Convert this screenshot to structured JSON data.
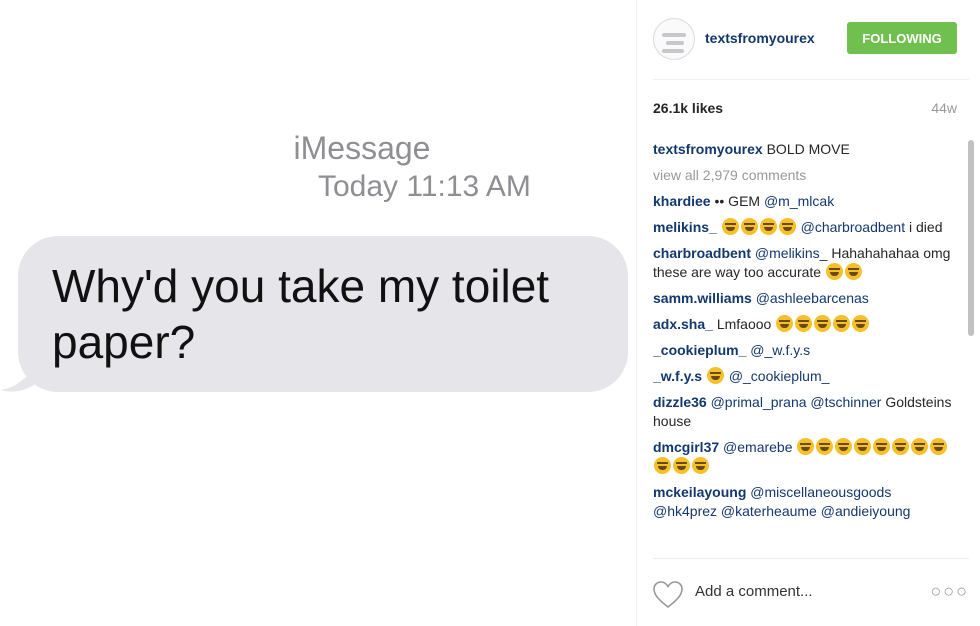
{
  "photo": {
    "imessage_label": "iMessage",
    "time_label": "Today 11:13 AM",
    "message_text": "Why'd you take my toilet paper?",
    "bubble_color": "#e5e5ea"
  },
  "post": {
    "username": "textsfromyourex",
    "follow_label": "FOLLOWING",
    "likes": "26.1k likes",
    "age": "44w",
    "caption_author": "textsfromyourex",
    "caption_text": "BOLD MOVE",
    "view_all": "view all 2,979 comments",
    "comments": [
      {
        "author": "khardiee",
        "text": "•• GEM",
        "mention": "@m_mlcak"
      },
      {
        "author": "melikins_",
        "emoji_count": 4,
        "mention": "@charbroadbent",
        "text": "i died"
      },
      {
        "author": "charbroadbent",
        "mention": "@melikins_",
        "text": "Hahahahahaa omg these are way too accurate",
        "emoji_count": 2
      },
      {
        "author": "samm.williams",
        "mention": "@ashleebarcenas"
      },
      {
        "author": "adx.sha_",
        "text": "Lmfaooo",
        "emoji_count": 5
      },
      {
        "author": "_cookieplum_",
        "mention": "@_w.f.y.s"
      },
      {
        "author": "_w.f.y.s",
        "emoji_count": 1,
        "mention": "@_cookieplum_"
      },
      {
        "author": "dizzle36",
        "mention": "@primal_prana @tschinner",
        "text": "Goldsteins house"
      },
      {
        "author": "dmcgirl37",
        "mention": "@emarebe",
        "emoji_count": 11
      },
      {
        "author": "mckeilayoung",
        "mention": "@miscellaneousgoods @hk4prez @katerheaume @andieiyoung"
      }
    ],
    "add_comment_placeholder": "Add a comment...",
    "more_icon": "ellipsis-icon",
    "accent_color": "#70c050",
    "link_color": "#12386e"
  }
}
